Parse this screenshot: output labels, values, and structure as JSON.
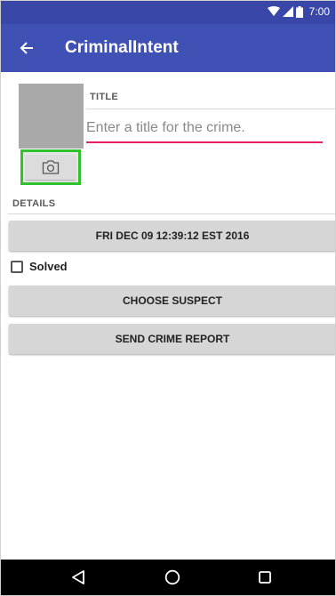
{
  "status_bar": {
    "time": "7:00"
  },
  "app_bar": {
    "title": "CriminalIntent"
  },
  "title_section": {
    "label": "TITLE",
    "placeholder": "Enter a title for the crime.",
    "value": ""
  },
  "details_section": {
    "label": "DETAILS",
    "date_button_label": "FRI DEC 09 12:39:12 EST 2016",
    "solved_label": "Solved",
    "solved_checked": false,
    "choose_suspect_label": "CHOOSE SUSPECT",
    "send_report_label": "SEND CRIME REPORT"
  },
  "icons": {
    "back": "arrow-left-icon",
    "camera": "camera-icon",
    "nav_back": "triangle-back-icon",
    "nav_home": "circle-home-icon",
    "nav_recents": "square-recents-icon"
  },
  "colors": {
    "app_bar": "#3f51b5",
    "status_bar": "#3947a8",
    "input_underline": "#e91e63",
    "camera_highlight": "#2fc12f"
  }
}
